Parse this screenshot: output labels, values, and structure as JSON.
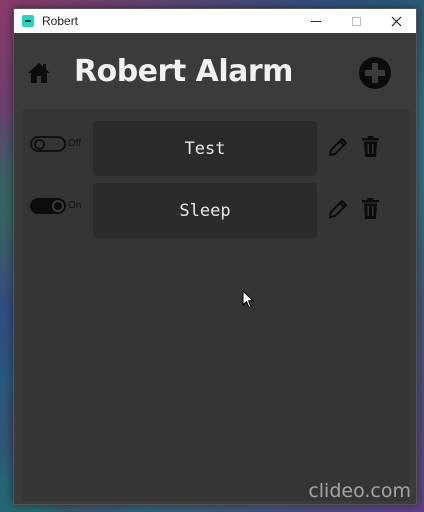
{
  "window": {
    "title": "Robert",
    "controls": [
      "minimize",
      "maximize",
      "close"
    ]
  },
  "header": {
    "home_icon": "home-icon",
    "title": "Robert Alarm",
    "add_icon": "plus-circle-icon"
  },
  "alarms": [
    {
      "name": "Test",
      "enabled": false,
      "toggle_label": "Off"
    },
    {
      "name": "Sleep",
      "enabled": true,
      "toggle_label": "On"
    }
  ],
  "row_icons": {
    "edit": "pencil-icon",
    "delete": "trash-icon"
  },
  "watermark": "clideo.com",
  "colors": {
    "window_bg": "#3b3b3b",
    "content_bg": "#353535",
    "card_bg": "#2b2b2b",
    "text": "#e8e8e8",
    "icon": "#0c0c0c",
    "app_icon": "#29d3c4"
  }
}
